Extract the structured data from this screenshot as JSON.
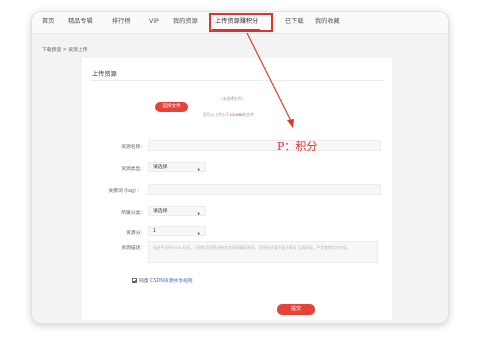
{
  "nav": {
    "items": [
      "首页",
      "精品专辑",
      "排行榜",
      "VIP",
      "我的资源",
      "上传资源赚积分",
      "已下载",
      "我的收藏"
    ],
    "highlighted": "上传资源赚积分",
    "highlight_color": "#e0342b"
  },
  "breadcrumb": "下载频道 > 资源上传",
  "form": {
    "title": "上传资源",
    "choose_file_label": "选择文件",
    "no_file_note": "(未选择文件)",
    "size_note_prefix": "您可以上传小于",
    "size_note_highlight": "220MB",
    "size_note_suffix": "的文件",
    "fields": {
      "name_label": "资源名称:",
      "type_label": "资源类型:",
      "type_value": "请选择",
      "tags_label": "关键词 (tag) :",
      "category_label": "所属分类:",
      "category_value": "请选择",
      "points_label": "资源分:",
      "points_value": "1",
      "desc_label": "资源描述:",
      "desc_placeholder": "描述不支持HTML标签，详细的资源描述有机会获得精彩推荐，资源描述请尽量正确而 且高质量，严禁复制相关内容。"
    },
    "agree_prefix": "同意",
    "agree_link": "CSDN资源共享规则",
    "submit_label": "提交",
    "button_color": "#e2443a"
  },
  "annotation": {
    "text": "P：积分",
    "color": "#e0342b"
  }
}
